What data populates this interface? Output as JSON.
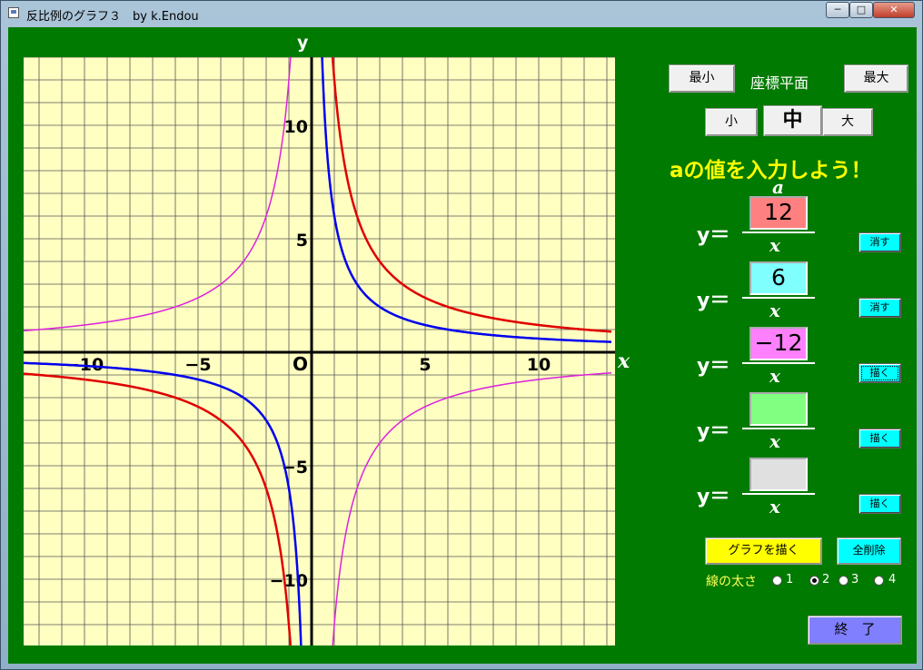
{
  "window": {
    "title": "反比例のグラフ３　by k.Endou"
  },
  "titlebar_buttons": {
    "min": "─",
    "max": "□",
    "close": "✕"
  },
  "graph": {
    "y_axis_label": "y",
    "x_axis_label": "x",
    "origin_label": "O",
    "x_ticks": [
      "−10",
      "−5",
      "5",
      "10"
    ],
    "y_ticks": [
      "10",
      "5",
      "−5",
      "−10"
    ],
    "range": [
      -13,
      13
    ],
    "curves": [
      {
        "a": 12,
        "color": "#e00000"
      },
      {
        "a": 6,
        "color": "#0000ee"
      },
      {
        "a": -12,
        "color": "#dd22dd"
      }
    ]
  },
  "plane": {
    "min_label": "最小",
    "title": "座標平面",
    "max_label": "最大"
  },
  "size_buttons": {
    "small": "小",
    "medium": "中",
    "large": "大"
  },
  "prompt": "aの値を入力しよう！",
  "a_label": "a",
  "equations": [
    {
      "y": "y＝",
      "value": "12",
      "color": "#ff8080",
      "denominator": "x",
      "button": "消す"
    },
    {
      "y": "y＝",
      "value": "6",
      "color": "#80ffff",
      "denominator": "x",
      "button": "消す"
    },
    {
      "y": "y＝",
      "value": "−12",
      "color": "#ff80ff",
      "denominator": "x",
      "button": "描く"
    },
    {
      "y": "y＝",
      "value": "",
      "color": "#80ff80",
      "denominator": "x",
      "button": "描く"
    },
    {
      "y": "y＝",
      "value": "",
      "color": "#e0e0e0",
      "denominator": "x",
      "button": "描く"
    }
  ],
  "draw_button": "グラフを描く",
  "clear_all_button": "全削除",
  "line_width": {
    "label": "線の太さ",
    "options": [
      "1",
      "2",
      "3",
      "4"
    ],
    "selected": "2"
  },
  "end_button": "終　了",
  "colors": {
    "background": "#007a00",
    "graph_bg": "#ffffc2",
    "prompt": "#ffff00",
    "draw_button": "#ffff00",
    "end_button": "#8080ff"
  }
}
